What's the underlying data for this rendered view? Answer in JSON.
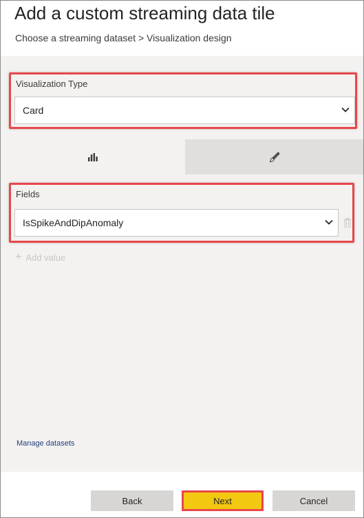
{
  "header": {
    "title": "Add a custom streaming data tile",
    "breadcrumb": "Choose a streaming dataset > Visualization design"
  },
  "visualization": {
    "label": "Visualization Type",
    "selected": "Card"
  },
  "tabs": {
    "fields_icon": "bar-chart-icon",
    "format_icon": "paintbrush-icon"
  },
  "fields": {
    "label": "Fields",
    "selected": "IsSpikeAndDipAnomaly",
    "add_value": "Add value"
  },
  "links": {
    "manage_datasets": "Manage datasets"
  },
  "buttons": {
    "back": "Back",
    "next": "Next",
    "cancel": "Cancel"
  },
  "colors": {
    "highlight": "#e8474a",
    "primary_button": "#f2c811",
    "panel_background": "#f3f2f1",
    "link": "#1f3f7a"
  }
}
